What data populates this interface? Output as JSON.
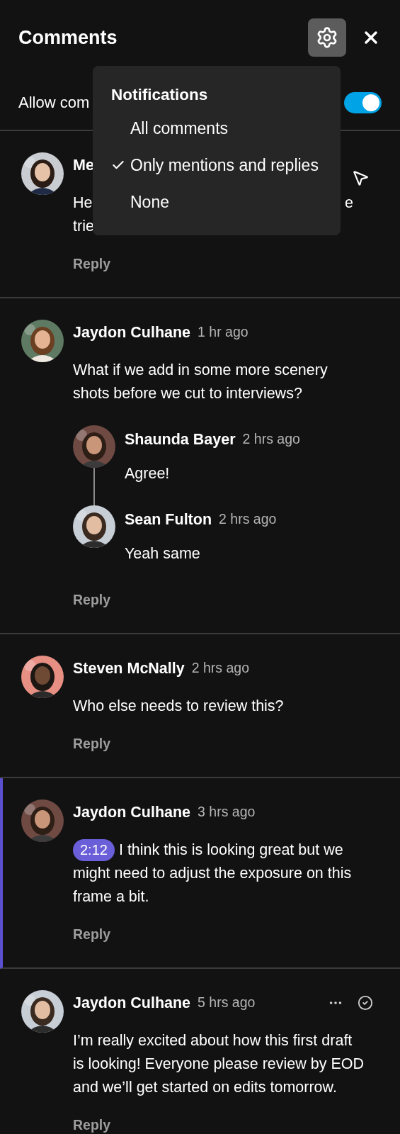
{
  "header": {
    "title": "Comments"
  },
  "allow_comments": {
    "label": "Allow com",
    "on": true
  },
  "notifications_menu": {
    "title": "Notifications",
    "items": [
      {
        "label": "All comments",
        "selected": false
      },
      {
        "label": "Only mentions and replies",
        "selected": true
      },
      {
        "label": "None",
        "selected": false
      }
    ]
  },
  "comments": [
    {
      "kind": "covered",
      "name": "Me",
      "body_lines": [
        "He",
        "trie"
      ],
      "body_tail": "e",
      "reply": "Reply",
      "highlighted": false,
      "actions": false
    },
    {
      "kind": "full",
      "name": "Jaydon Culhane",
      "time": "1 hr ago",
      "body": "What if we add in some more scenery shots before we cut to interviews?",
      "replies": [
        {
          "name": "Shaunda Bayer",
          "time": "2 hrs ago",
          "body": "Agree!"
        },
        {
          "name": "Sean Fulton",
          "time": "2 hrs ago",
          "body": "Yeah same"
        }
      ],
      "reply": "Reply",
      "highlighted": false,
      "actions": false
    },
    {
      "kind": "full",
      "name": "Steven McNally",
      "time": "2 hrs ago",
      "body": "Who else needs to review this?",
      "reply": "Reply",
      "highlighted": false,
      "actions": false
    },
    {
      "kind": "full",
      "name": "Jaydon Culhane",
      "time": "3 hrs ago",
      "timestamp": "2:12",
      "body": "I think this is looking great but we might need to adjust the exposure on this frame a bit.",
      "reply": "Reply",
      "highlighted": true,
      "actions": false
    },
    {
      "kind": "full",
      "name": "Jaydon Culhane",
      "time": "5 hrs ago",
      "body": "I’m really excited about how this first draft is looking! Everyone please review by EOD and we’ll get started on edits tomorrow.",
      "reply": "Reply",
      "highlighted": false,
      "actions": true
    }
  ]
}
